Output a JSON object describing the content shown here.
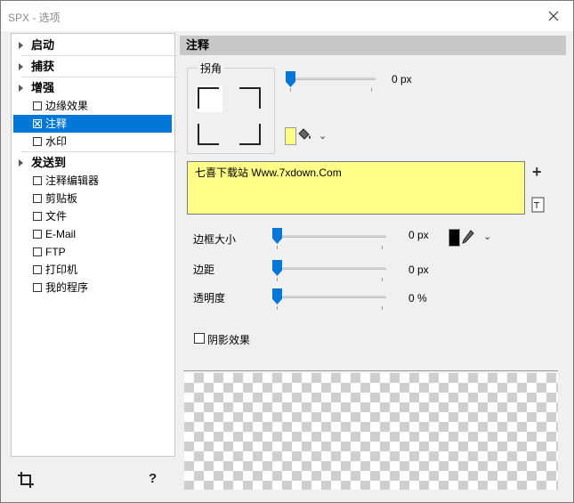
{
  "window": {
    "title": "SPX - 选项"
  },
  "tree": {
    "items": [
      {
        "label": "启动",
        "type": "category"
      },
      {
        "label": "捕获",
        "type": "category"
      },
      {
        "label": "增强",
        "type": "category"
      },
      {
        "label": "边缘效果",
        "type": "checkbox",
        "checked": false
      },
      {
        "label": "注释",
        "type": "checkbox",
        "checked": true,
        "selected": true
      },
      {
        "label": "水印",
        "type": "checkbox",
        "checked": false
      },
      {
        "label": "发送到",
        "type": "category"
      },
      {
        "label": "注释编辑器",
        "type": "checkbox",
        "checked": false
      },
      {
        "label": "剪贴板",
        "type": "checkbox",
        "checked": false
      },
      {
        "label": "文件",
        "type": "checkbox",
        "checked": false
      },
      {
        "label": "E-Mail",
        "type": "checkbox",
        "checked": false
      },
      {
        "label": "FTP",
        "type": "checkbox",
        "checked": false
      },
      {
        "label": "打印机",
        "type": "checkbox",
        "checked": false
      },
      {
        "label": "我的程序",
        "type": "checkbox",
        "checked": false
      }
    ]
  },
  "panel": {
    "header": "注释",
    "corner": {
      "label": "拐角",
      "value": "0 px",
      "level": 0
    },
    "note_text": "七喜下载站 Www.7xdown.Com",
    "border_size": {
      "label": "边框大小",
      "value": "0 px",
      "level": 0
    },
    "margin": {
      "label": "边距",
      "value": "0 px",
      "level": 0
    },
    "opacity": {
      "label": "透明度",
      "value": "0 %",
      "level": 0
    },
    "shadow": {
      "label": "阴影效果",
      "checked": false
    }
  },
  "colors": {
    "accent": "#0078d7",
    "note_background": "#ffff88",
    "fill_color": "#ffff88",
    "border_color": "#000000"
  }
}
